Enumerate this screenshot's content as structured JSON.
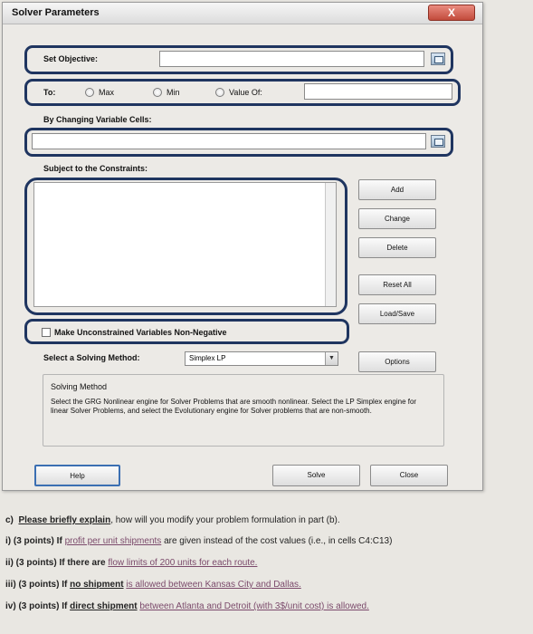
{
  "dialog": {
    "title": "Solver Parameters",
    "close_label": "X",
    "objective_label": "Set Objective:",
    "objective_value": "",
    "to_label": "To:",
    "radio_max": "Max",
    "radio_min": "Min",
    "radio_value_of": "Value Of:",
    "value_of_value": "",
    "changing_cells_label": "By Changing Variable Cells:",
    "changing_cells_value": "",
    "constraints_label": "Subject to the Constraints:",
    "buttons": {
      "add": "Add",
      "change": "Change",
      "delete": "Delete",
      "reset_all": "Reset All",
      "load_save": "Load/Save",
      "options": "Options",
      "help": "Help",
      "solve": "Solve",
      "close": "Close"
    },
    "nonneg_label": "Make Unconstrained Variables Non-Negative",
    "method_label": "Select a Solving Method:",
    "method_value": "Simplex LP",
    "solving_method_title": "Solving Method",
    "solving_method_desc": "Select the GRG Nonlinear engine for Solver Problems that are smooth nonlinear. Select the LP Simplex engine for linear Solver Problems, and select the Evolutionary engine for Solver problems that are non-smooth."
  },
  "question": {
    "c_prefix": "c)",
    "c_link": "Please briefly explain",
    "c_rest": ", how will you modify your problem formulation in part (b).",
    "i_prefix": "i) (3 points) If",
    "i_link": "profit per unit shipments",
    "i_rest": "are given instead of the cost values (i.e., in cells C4:C13)",
    "ii_prefix": "ii) (3 points) If there are",
    "ii_link": "flow limits of 200 units for each route.",
    "iii_prefix": "iii) (3 points) If",
    "iii_link1": "no shipment",
    "iii_link2": "is allowed between Kansas City and Dallas.",
    "iv_prefix": "iv) (3 points) If",
    "iv_link1": "direct shipment",
    "iv_link2": "between Atlanta and Detroit (with 3$/unit cost) is allowed."
  }
}
